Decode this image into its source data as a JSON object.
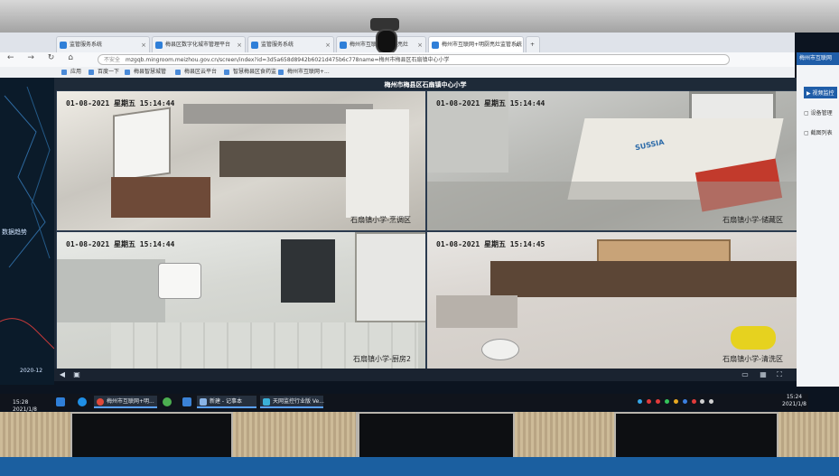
{
  "browser": {
    "tabs": [
      {
        "label": "监管服务系统"
      },
      {
        "label": "梅县区数字化城市管理平台"
      },
      {
        "label": "监管服务系统"
      },
      {
        "label": "梅州市互联网+明厨亮灶"
      },
      {
        "label": "梅州市互联网+明厨亮灶监管系统"
      }
    ],
    "nav_glyphs": "← → ↻ ⌂",
    "insecure_label": "不安全",
    "url": "mzgqb.mingroom.meizhou.gov.cn/screen/index?id=3d5a658d8942b6021d475b6c778name=梅州市梅县区石扇镇中心小学",
    "bookmarks": [
      {
        "label": "应用"
      },
      {
        "label": "百度一下"
      },
      {
        "label": "梅县智慧城管"
      },
      {
        "label": "梅县区云平台"
      },
      {
        "label": "智慧梅县区食药监"
      },
      {
        "label": "梅州市互联网+..."
      }
    ]
  },
  "left_panel": {
    "label": "数据趋势",
    "date": "2020-12"
  },
  "video_wall": {
    "title": "梅州市梅县区石扇镇中心小学",
    "feeds": [
      {
        "timestamp": "01-08-2021 星期五 15:14:44",
        "location": "石扇镇小学-烹调区"
      },
      {
        "timestamp": "01-08-2021 星期五 15:14:44",
        "location": "石扇镇小学-储藏区"
      },
      {
        "timestamp": "01-08-2021 星期五 15:14:44",
        "location": "石扇镇小学-厨房2"
      },
      {
        "timestamp": "01-08-2021 星期五 15:14:45",
        "location": "石扇镇小学-清洗区"
      }
    ],
    "sack_brand": "SUSSIA"
  },
  "right_panel": {
    "header": "梅州市互联网",
    "items": [
      {
        "label": "视频监控",
        "icon": "video-icon"
      },
      {
        "label": "设备管理",
        "icon": "device-icon"
      },
      {
        "label": "截图列表",
        "icon": "screenshot-icon"
      }
    ]
  },
  "taskbar": {
    "left_clock": {
      "time": "15:28",
      "date": "2021/1/8"
    },
    "buttons": [
      {
        "label": "梅州市互联网+明..."
      },
      {
        "label": "新建 - 记事本"
      },
      {
        "label": "天网监控行业版 Ve..."
      }
    ],
    "clock": {
      "time": "15:24",
      "date": "2021/1/8"
    }
  }
}
